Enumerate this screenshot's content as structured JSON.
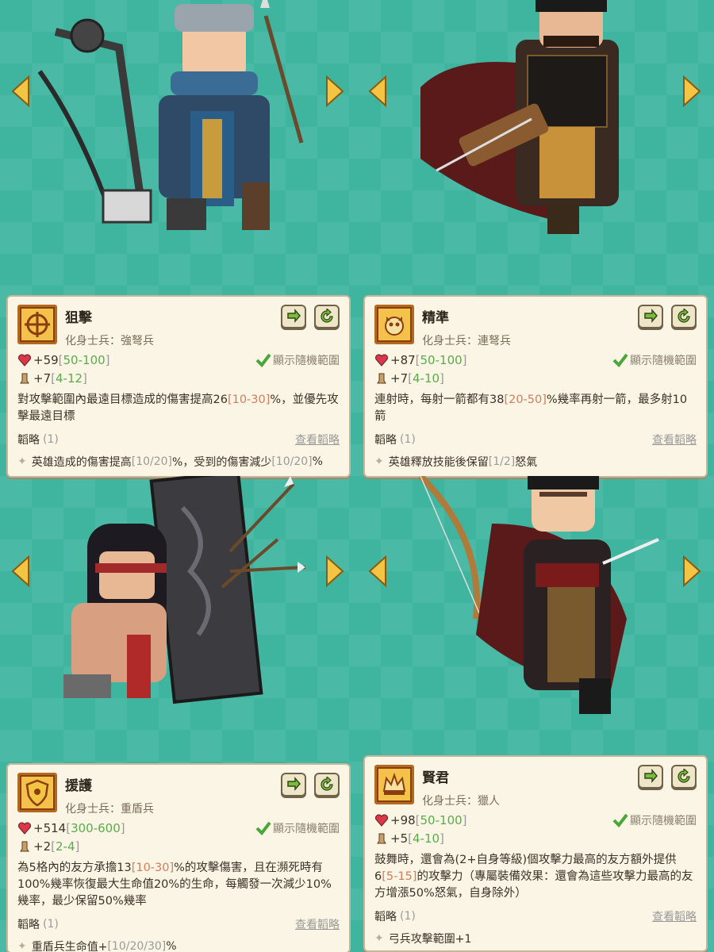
{
  "common": {
    "show_range_label": "顯示隨機範圍",
    "strategy_label": "韜略",
    "view_strategy_label": "查看韜略"
  },
  "cards": [
    {
      "name": "狙擊",
      "subtitle": "化身士兵：強弩兵",
      "hp": "+59",
      "hp_range": [
        "[",
        "50",
        "-",
        "100",
        "]"
      ],
      "atk": "+7",
      "atk_range": [
        "[",
        "4",
        "-",
        "12",
        "]"
      ],
      "desc": [
        "對攻擊範圍內最遠目標造成的傷害提高",
        "26",
        "[10-30]",
        "%，並優先攻擊最遠目標"
      ],
      "strategy_count": "(1)",
      "strategy_item": [
        "英雄造成的傷害提高",
        "[10/20]",
        "%，受到的傷害減少",
        "[10/20]",
        "%"
      ]
    },
    {
      "name": "精準",
      "subtitle": "化身士兵：連弩兵",
      "hp": "+87",
      "hp_range": [
        "[",
        "50",
        "-",
        "100",
        "]"
      ],
      "atk": "+7",
      "atk_range": [
        "[",
        "4",
        "-",
        "10",
        "]"
      ],
      "desc": [
        "連射時，每射一箭都有",
        "38",
        "[20-50]",
        "%幾率再射一箭，最多射10箭"
      ],
      "strategy_count": "(1)",
      "strategy_item": [
        "英雄釋放技能後保留",
        "[1/2]",
        "怒氣"
      ]
    },
    {
      "name": "援護",
      "subtitle": "化身士兵：重盾兵",
      "hp": "+514",
      "hp_range": [
        "[",
        "300",
        "-",
        "600",
        "]"
      ],
      "atk": "+2",
      "atk_range": [
        "[",
        "2",
        "-",
        "4",
        "]"
      ],
      "desc": [
        "為5格內的友方承擔",
        "13",
        "[10-30]",
        "%的攻擊傷害，且在瀕死時有100%幾率恢復最大生命值20%的生命，每觸發一次減少10%幾率，最少保留50%幾率"
      ],
      "strategy_count": "(1)",
      "strategy_item": [
        "重盾兵生命值+",
        "[10/20/30]",
        "%"
      ]
    },
    {
      "name": "賢君",
      "subtitle": "化身士兵：獵人",
      "hp": "+98",
      "hp_range": [
        "[",
        "50",
        "-",
        "100",
        "]"
      ],
      "atk": "+5",
      "atk_range": [
        "[",
        "4",
        "-",
        "10",
        "]"
      ],
      "desc": [
        "鼓舞時，還會為(2+自身等級)個攻擊力最高的友方額外提供",
        "6",
        "[5-15]",
        "的攻擊力（專屬裝備效果：還會為這些攻擊力最高的友方增漲50%怒氣，自身除外）"
      ],
      "strategy_count": "(1)",
      "strategy_item": [
        "弓兵攻擊範圍+1"
      ]
    }
  ]
}
